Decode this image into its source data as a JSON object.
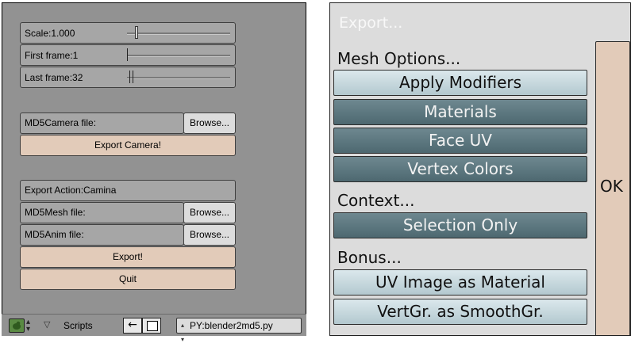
{
  "left": {
    "scale_label": "Scale:1.000",
    "first_frame_label": "First frame:1",
    "last_frame_label": "Last frame:32",
    "md5camera_label": "MD5Camera file:",
    "browse_label": "Browse...",
    "export_camera_label": "Export Camera!",
    "export_action_label": "Export Action:Camina",
    "md5mesh_label": "MD5Mesh file:",
    "md5anim_label": "MD5Anim file:",
    "export_label": "Export!",
    "quit_label": "Quit",
    "status": {
      "scripts_label": "Scripts",
      "script_file": "PY:blender2md5.py",
      "back_arrow": "←"
    }
  },
  "right": {
    "title": "Export...",
    "mesh_options_label": "Mesh Options...",
    "apply_modifiers": "Apply Modifiers",
    "materials": "Materials",
    "face_uv": "Face UV",
    "vertex_colors": "Vertex Colors",
    "context_label": "Context...",
    "selection_only": "Selection Only",
    "bonus_label": "Bonus...",
    "uv_image_material": "UV Image as Material",
    "vertgr_smoothgr": "VertGr. as SmoothGr.",
    "ok_label": "OK"
  },
  "colors": {
    "panel_grey": "#929292",
    "field_grey": "#a6a6a6",
    "button_tan": "#e2cbb9",
    "toggle_light": "#c3d5db",
    "toggle_dark": "#5a767e"
  }
}
